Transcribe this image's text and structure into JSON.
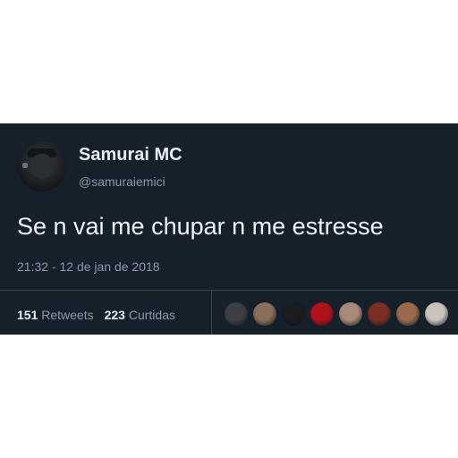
{
  "tweet": {
    "display_name": "Samurai MC",
    "handle": "@samuraiemici",
    "text": "Se n vai me chupar n me estresse",
    "timestamp": "21:32 - 12 de jan de 2018",
    "retweets_count": "151",
    "retweets_label": "Retweets",
    "likes_count": "223",
    "likes_label": "Curtidas"
  },
  "colors": {
    "card_background": "#15202b",
    "text_primary": "#e8eef4",
    "text_secondary": "#8899a6"
  },
  "liker_avatars": [
    {
      "color": "#3d3f44"
    },
    {
      "color": "#8a6e5a"
    },
    {
      "color": "#1b1c1f"
    },
    {
      "color": "#b2121b"
    },
    {
      "color": "#a88a78"
    },
    {
      "color": "#7a2f22"
    },
    {
      "color": "#9b6a4c"
    },
    {
      "color": "#c8c3bd"
    }
  ]
}
